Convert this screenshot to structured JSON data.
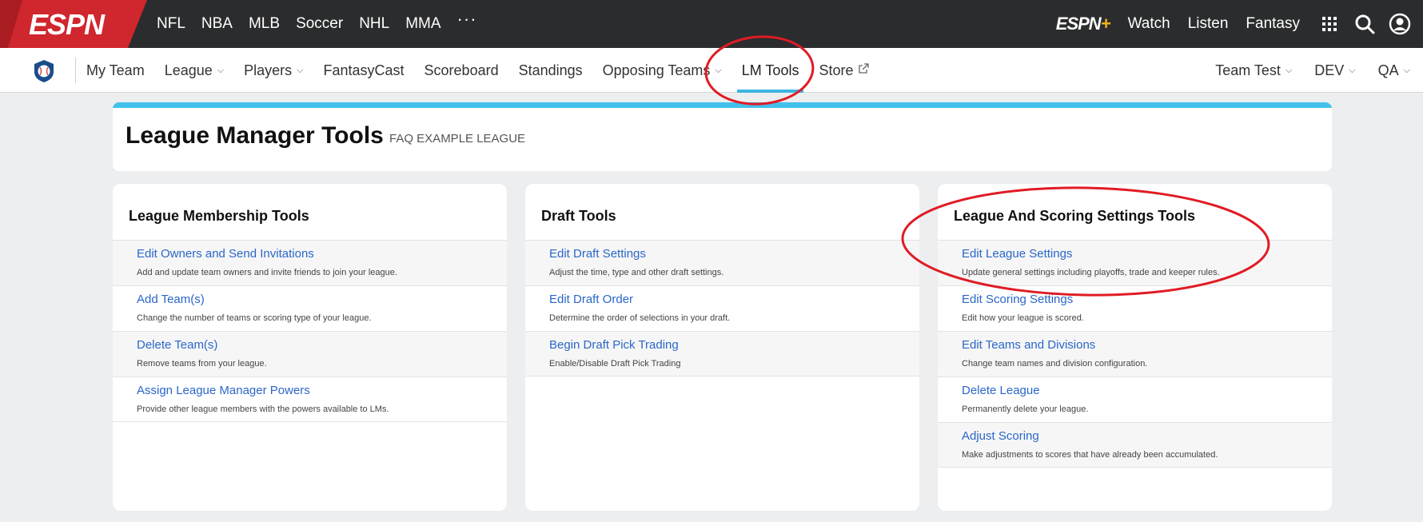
{
  "topbar": {
    "logo": "ESPN",
    "sports": [
      "NFL",
      "NBA",
      "MLB",
      "Soccer",
      "NHL",
      "MMA"
    ],
    "more_label": "···",
    "espn_plus": "ESPN",
    "espn_plus_mark": "+",
    "right_links": [
      "Watch",
      "Listen",
      "Fantasy"
    ]
  },
  "fantasy_nav": {
    "items": [
      {
        "label": "My Team",
        "dropdown": false
      },
      {
        "label": "League",
        "dropdown": true
      },
      {
        "label": "Players",
        "dropdown": true
      },
      {
        "label": "FantasyCast",
        "dropdown": false
      },
      {
        "label": "Scoreboard",
        "dropdown": false
      },
      {
        "label": "Standings",
        "dropdown": false
      },
      {
        "label": "Opposing Teams",
        "dropdown": true
      },
      {
        "label": "LM Tools",
        "dropdown": false,
        "active": true
      },
      {
        "label": "Store",
        "dropdown": false,
        "external": true
      }
    ],
    "right": [
      "Team Test",
      "DEV",
      "QA"
    ],
    "chevron": "⌵"
  },
  "header": {
    "title": "League Manager Tools",
    "subtitle": "FAQ EXAMPLE LEAGUE"
  },
  "panels": [
    {
      "title": "League Membership Tools",
      "rows": [
        {
          "link": "Edit Owners and Send Invitations",
          "desc": "Add and update team owners and invite friends to join your league."
        },
        {
          "link": "Add Team(s)",
          "desc": "Change the number of teams or scoring type of your league."
        },
        {
          "link": "Delete Team(s)",
          "desc": "Remove teams from your league."
        },
        {
          "link": "Assign League Manager Powers",
          "desc": "Provide other league members with the powers available to LMs."
        }
      ]
    },
    {
      "title": "Draft Tools",
      "rows": [
        {
          "link": "Edit Draft Settings",
          "desc": "Adjust the time, type and other draft settings."
        },
        {
          "link": "Edit Draft Order",
          "desc": "Determine the order of selections in your draft."
        },
        {
          "link": "Begin Draft Pick Trading",
          "desc": "Enable/Disable Draft Pick Trading"
        }
      ]
    },
    {
      "title": "League And Scoring Settings Tools",
      "rows": [
        {
          "link": "Edit League Settings",
          "desc": "Update general settings including playoffs, trade and keeper rules."
        },
        {
          "link": "Edit Scoring Settings",
          "desc": "Edit how your league is scored."
        },
        {
          "link": "Edit Teams and Divisions",
          "desc": "Change team names and division configuration."
        },
        {
          "link": "Delete League",
          "desc": "Permanently delete your league."
        },
        {
          "link": "Adjust Scoring",
          "desc": "Make adjustments to scores that have already been accumulated."
        }
      ]
    }
  ],
  "colors": {
    "topbar_bg": "#2b2c2d",
    "espn_red": "#d0262e",
    "link_blue": "#2a67c9",
    "accent_blue": "#43c1ea",
    "annotation_red": "#e01b24"
  }
}
